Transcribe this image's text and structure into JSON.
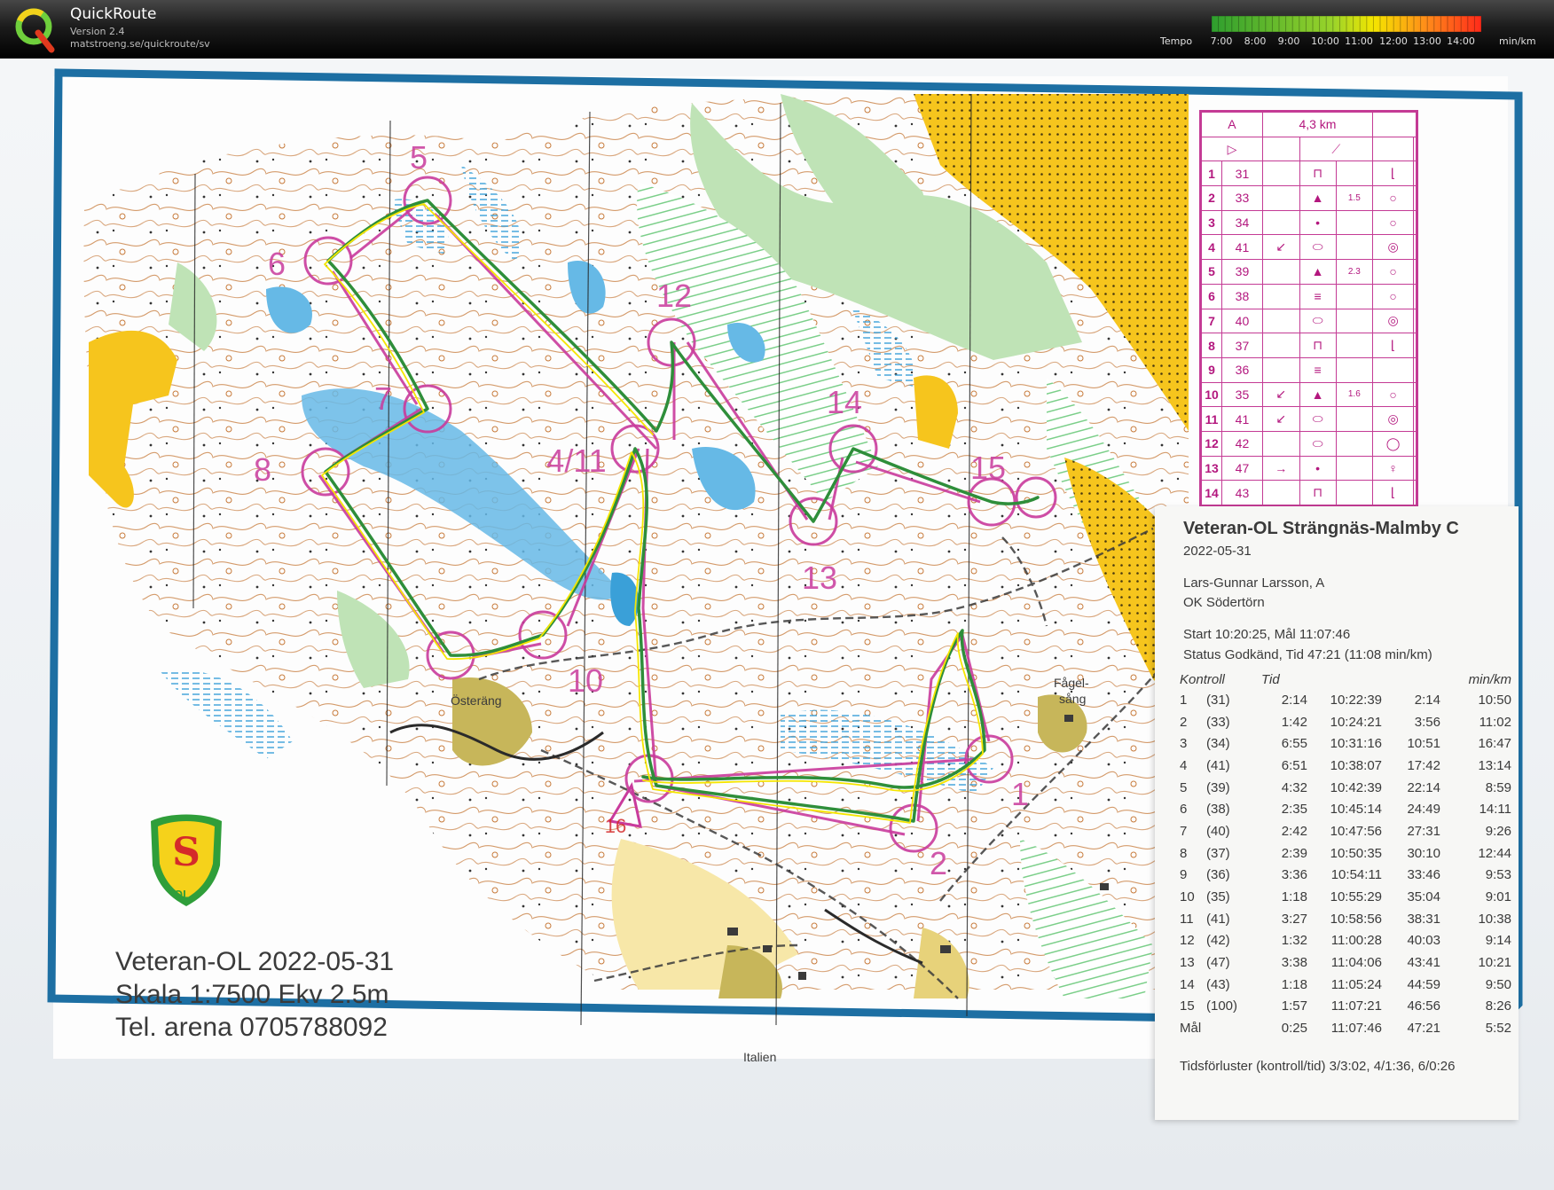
{
  "app": {
    "name": "QuickRoute",
    "version": "Version 2.4",
    "url": "matstroeng.se/quickroute/sv",
    "logo_icon": "quickroute-q-logo"
  },
  "tempo_legend": {
    "label": "Tempo",
    "unit": "min/km",
    "ticks": [
      "7:00",
      "8:00",
      "9:00",
      "10:00",
      "11:00",
      "12:00",
      "13:00",
      "14:00"
    ],
    "colors": [
      "#2e9e2e",
      "#f5e600",
      "#ff2a1a"
    ]
  },
  "map": {
    "info_lines": [
      "Veteran-OL 2022-05-31",
      "Skala 1:7500 Ekv 2.5m",
      "Tel. arena 0705788092"
    ],
    "control_labels": [
      "5",
      "6",
      "7",
      "8",
      "12",
      "4/11",
      "14",
      "15",
      "13",
      "10",
      "1",
      "2",
      "16"
    ],
    "place_names": [
      "Österäng",
      "Fågel-",
      "sång",
      "Italien"
    ],
    "club_logo_icon": "ssol-club-shield-icon",
    "club_logo_text": "OL",
    "course_color": "#c93b9c",
    "route_colors": [
      "#2e9e2e",
      "#f5e600"
    ]
  },
  "description_sheet": {
    "header": [
      "A",
      "4,3 km"
    ],
    "rows": [
      {
        "n": "1",
        "code": "31",
        "extra": ""
      },
      {
        "n": "2",
        "code": "33",
        "extra": "1.5"
      },
      {
        "n": "3",
        "code": "34",
        "extra": ""
      },
      {
        "n": "4",
        "code": "41",
        "extra": ""
      },
      {
        "n": "5",
        "code": "39",
        "extra": "2.3"
      },
      {
        "n": "6",
        "code": "38",
        "extra": ""
      },
      {
        "n": "7",
        "code": "40",
        "extra": ""
      },
      {
        "n": "8",
        "code": "37",
        "extra": ""
      },
      {
        "n": "9",
        "code": "36",
        "extra": ""
      },
      {
        "n": "10",
        "code": "35",
        "extra": "1.6"
      },
      {
        "n": "11",
        "code": "41",
        "extra": ""
      },
      {
        "n": "12",
        "code": "42",
        "extra": ""
      },
      {
        "n": "13",
        "code": "47",
        "extra": ""
      },
      {
        "n": "14",
        "code": "43",
        "extra": ""
      }
    ]
  },
  "receipt": {
    "title": "Veteran-OL Strängnäs-Malmby C",
    "date": "2022-05-31",
    "runner": "Lars-Gunnar Larsson, A",
    "club": "OK Södertörn",
    "start_finish": "Start  10:20:25, Mål  11:07:46",
    "status": "Status  Godkänd, Tid  47:21 (11:08 min/km)",
    "columns": [
      "Kontroll",
      "",
      "Tid",
      "",
      "",
      "min/km"
    ],
    "splits": [
      [
        "1",
        "(31)",
        "2:14",
        "10:22:39",
        "2:14",
        "10:50"
      ],
      [
        "2",
        "(33)",
        "1:42",
        "10:24:21",
        "3:56",
        "11:02"
      ],
      [
        "3",
        "(34)",
        "6:55",
        "10:31:16",
        "10:51",
        "16:47"
      ],
      [
        "4",
        "(41)",
        "6:51",
        "10:38:07",
        "17:42",
        "13:14"
      ],
      [
        "5",
        "(39)",
        "4:32",
        "10:42:39",
        "22:14",
        "8:59"
      ],
      [
        "6",
        "(38)",
        "2:35",
        "10:45:14",
        "24:49",
        "14:11"
      ],
      [
        "7",
        "(40)",
        "2:42",
        "10:47:56",
        "27:31",
        "9:26"
      ],
      [
        "8",
        "(37)",
        "2:39",
        "10:50:35",
        "30:10",
        "12:44"
      ],
      [
        "9",
        "(36)",
        "3:36",
        "10:54:11",
        "33:46",
        "9:53"
      ],
      [
        "10",
        "(35)",
        "1:18",
        "10:55:29",
        "35:04",
        "9:01"
      ],
      [
        "11",
        "(41)",
        "3:27",
        "10:58:56",
        "38:31",
        "10:38"
      ],
      [
        "12",
        "(42)",
        "1:32",
        "11:00:28",
        "40:03",
        "9:14"
      ],
      [
        "13",
        "(47)",
        "3:38",
        "11:04:06",
        "43:41",
        "10:21"
      ],
      [
        "14",
        "(43)",
        "1:18",
        "11:05:24",
        "44:59",
        "9:50"
      ],
      [
        "15",
        "(100)",
        "1:57",
        "11:07:21",
        "46:56",
        "8:26"
      ],
      [
        "Mål",
        "",
        "0:25",
        "11:07:46",
        "47:21",
        "5:52"
      ]
    ],
    "losses": "Tidsförluster (kontroll/tid)  3/3:02, 4/1:36, 6/0:26"
  }
}
